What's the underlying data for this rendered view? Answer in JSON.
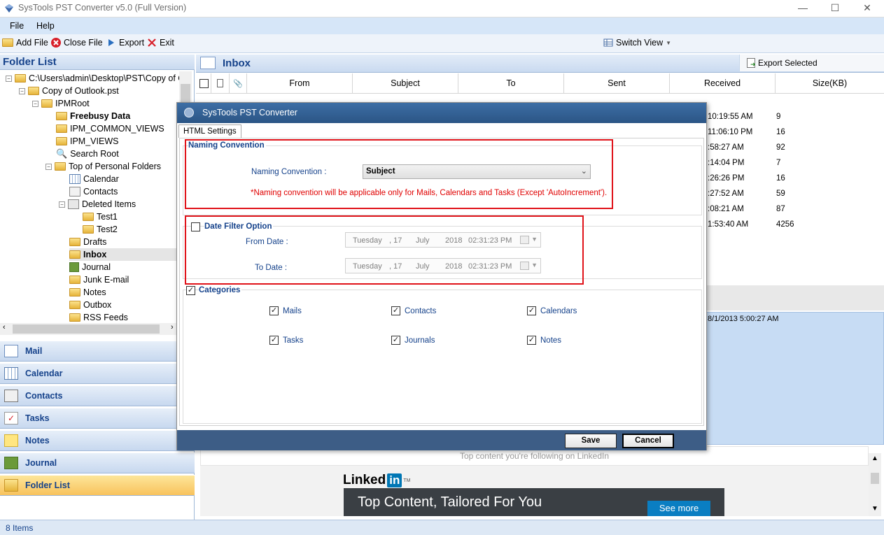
{
  "window": {
    "title": "SysTools  PST Converter v5.0 (Full Version)",
    "minimize": "—",
    "maximize": "☐",
    "close": "✕"
  },
  "menu": [
    "File",
    "Help"
  ],
  "toolbar": {
    "add_file": "Add File",
    "close_file": "Close File",
    "export": "Export",
    "exit": "Exit",
    "switch_view": "Switch View"
  },
  "folder_list": {
    "title": "Folder List",
    "tree": [
      {
        "label": "C:\\Users\\admin\\Desktop\\PST\\Copy of O",
        "bold": false
      },
      {
        "label": "Copy of Outlook.pst",
        "bold": false
      },
      {
        "label": "IPMRoot",
        "bold": false
      },
      {
        "label": "Freebusy Data",
        "bold": true
      },
      {
        "label": "IPM_COMMON_VIEWS",
        "bold": false
      },
      {
        "label": "IPM_VIEWS",
        "bold": false
      },
      {
        "label": "Search Root",
        "bold": false
      },
      {
        "label": "Top of Personal Folders",
        "bold": false
      },
      {
        "label": "Calendar",
        "bold": false
      },
      {
        "label": "Contacts",
        "bold": false
      },
      {
        "label": "Deleted Items",
        "bold": false
      },
      {
        "label": "Test1",
        "bold": false
      },
      {
        "label": "Test2",
        "bold": false
      },
      {
        "label": "Drafts",
        "bold": false
      },
      {
        "label": "Inbox",
        "bold": true
      },
      {
        "label": "Journal",
        "bold": false
      },
      {
        "label": "Junk E-mail",
        "bold": false
      },
      {
        "label": "Notes",
        "bold": false
      },
      {
        "label": "Outbox",
        "bold": false
      },
      {
        "label": "RSS Feeds",
        "bold": false
      }
    ]
  },
  "nav": [
    "Mail",
    "Calendar",
    "Contacts",
    "Tasks",
    "Notes",
    "Journal",
    "Folder List"
  ],
  "inbox": {
    "title": "Inbox",
    "export_selected": "Export Selected",
    "columns": [
      "From",
      "Subject",
      "To",
      "Sent",
      "Received",
      "Size(KB)"
    ],
    "rows": [
      {
        "received": "10:19:55 AM",
        "size": "9"
      },
      {
        "received": "11:06:10 PM",
        "size": "16"
      },
      {
        "received": ":58:27 AM",
        "size": "92"
      },
      {
        "received": ":14:04 PM",
        "size": "7"
      },
      {
        "received": ":26:26 PM",
        "size": "16"
      },
      {
        "received": ":27:52 AM",
        "size": "59"
      },
      {
        "received": ":08:21 AM",
        "size": "87"
      },
      {
        "received": "1:53:40 AM",
        "size": "4256"
      }
    ],
    "preview_date": "8/1/2013 5:00:27 AM",
    "web_top": "Top content you're following on LinkedIn",
    "linkedin": "Linked",
    "linkedin_in": "in",
    "linkedin_tm": "TM",
    "promo_text": "Top Content, Tailored For You",
    "see_more": "See more"
  },
  "status": "8 Items",
  "dialog": {
    "title": "SysTools  PST Converter",
    "tab": "HTML Settings",
    "naming": {
      "group": "Naming Convention",
      "label": "Naming Convention :",
      "selected": "Subject",
      "note": "*Naming convention will be applicable only for Mails, Calendars and Tasks (Except 'AutoIncrement')."
    },
    "date_filter": {
      "group": "Date Filter Option",
      "from_label": "From Date     :",
      "to_label": "To Date       :",
      "from": {
        "day": "Tuesday",
        "date": ", 17",
        "month": "July",
        "year": "2018",
        "time": "02:31:23 PM"
      },
      "to": {
        "day": "Tuesday",
        "date": ", 17",
        "month": "July",
        "year": "2018",
        "time": "02:31:23 PM"
      }
    },
    "categories": {
      "group": "Categories",
      "items": [
        "Mails",
        "Contacts",
        "Calendars",
        "Tasks",
        "Journals",
        "Notes"
      ]
    },
    "save": "Save",
    "cancel": "Cancel"
  },
  "colors": {
    "accent_blue": "#15428b",
    "highlight_red": "#e0131a",
    "dialog_title": "#3d6ea5"
  }
}
